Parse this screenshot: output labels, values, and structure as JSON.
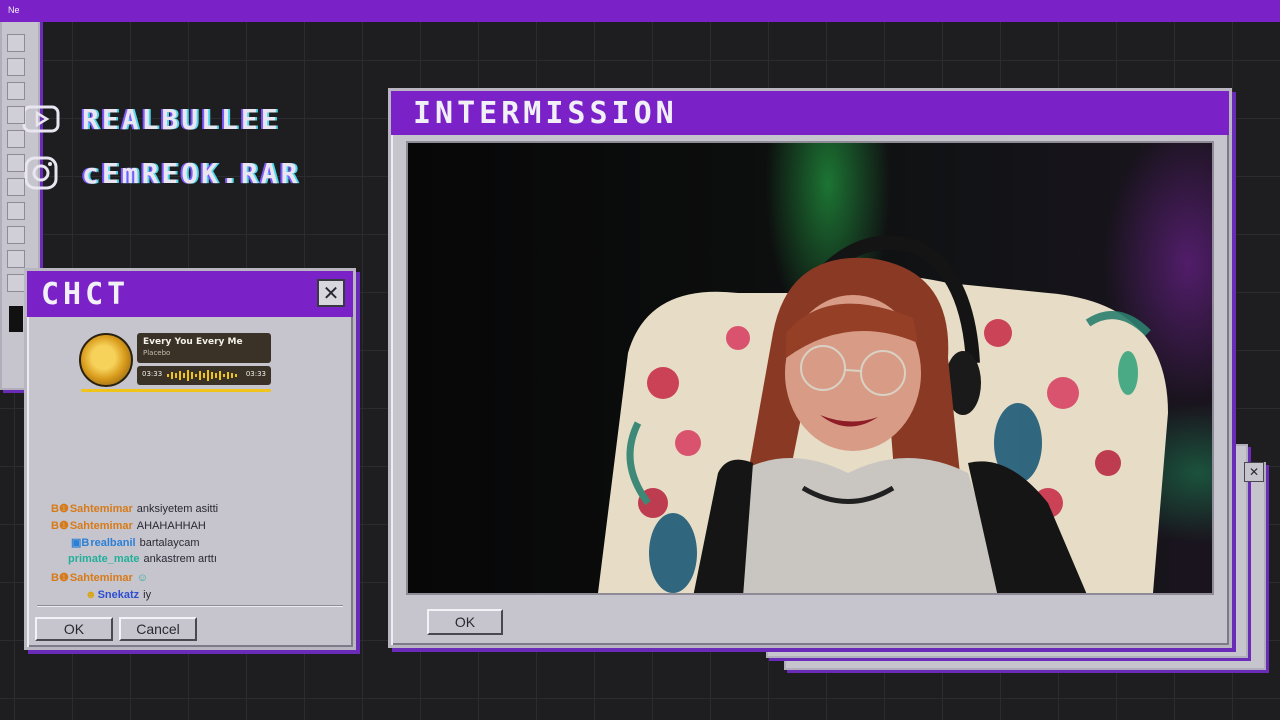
{
  "socials": [
    {
      "icon": "youtube-icon",
      "handle": "REALBULLEE"
    },
    {
      "icon": "instagram-icon",
      "handle": "cEmREOK.RAR"
    }
  ],
  "chat_window": {
    "title": "CHCT",
    "close_glyph": "✕",
    "now_playing": {
      "song": "Every You Every Me",
      "artist": "Placebo",
      "elapsed": "03:33",
      "duration": "03:33"
    },
    "messages": [
      {
        "badges": "B❶",
        "user": "Sahtemimar",
        "text": "anksiyetem asitti",
        "user_color": "#d77a18"
      },
      {
        "badges": "B❶",
        "user": "Sahtemimar",
        "text": "AHAHAHHAH",
        "user_color": "#d77a18"
      },
      {
        "badges": "▣B",
        "user": "realbanil",
        "text": "bartalaycam",
        "user_color": "#2a7fd6"
      },
      {
        "badges": "",
        "user": "primate_mate",
        "text": "ankastrem arttı",
        "user_color": "#22b09a"
      },
      {
        "badges": "B❶",
        "user": "Sahtemimar",
        "text": "☺",
        "user_color": "#d77a18"
      },
      {
        "badges": "☻",
        "user": "Snekatz",
        "text": "iy",
        "user_color": "#2d4fd0"
      }
    ],
    "ok_label": "OK",
    "cancel_label": "Cancel"
  },
  "paint_window": {
    "title": "Ne"
  },
  "intermission_window": {
    "title": "INTERMISSION",
    "ok_label": "OK"
  },
  "colors": {
    "accent_purple": "#7a22c8",
    "window_gray": "#c6c4cd",
    "background": "#1e1e20"
  }
}
